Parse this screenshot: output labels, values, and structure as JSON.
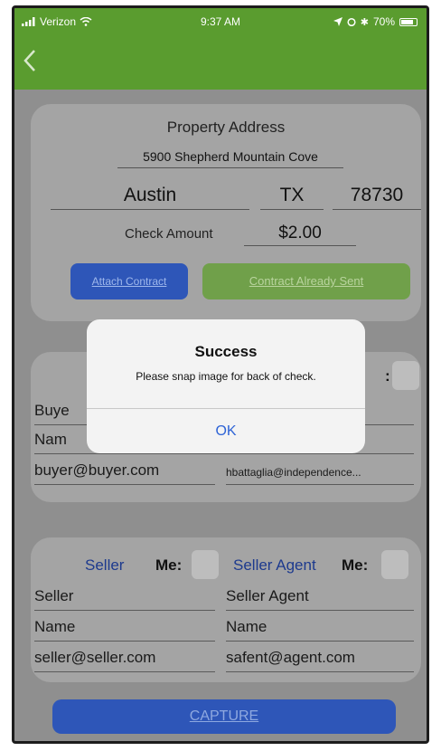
{
  "status_bar": {
    "carrier": "Verizon",
    "time": "9:37 AM",
    "battery": "70%"
  },
  "property": {
    "title": "Property Address",
    "street": "5900 Shepherd Mountain Cove",
    "city": "Austin",
    "state": "TX",
    "zip": "78730",
    "check_amount_label": "Check Amount",
    "check_amount": "$2.00",
    "attach_button": "Attach Contract",
    "sent_button": "Contract Already Sent"
  },
  "buyer": {
    "label": "Buye",
    "name_label": "Nam",
    "email": "buyer@buyer.com",
    "agent_email": "hbattaglia@independence...",
    "colon": ":"
  },
  "seller": {
    "seller_label": "Seller",
    "me_label": "Me:",
    "agent_label": "Seller Agent",
    "agent_me_label": "Me:",
    "seller_field": "Seller",
    "seller_name": "Name",
    "seller_email": "seller@seller.com",
    "agent_field": "Seller Agent",
    "agent_name": "Name",
    "agent_email": "safent@agent.com"
  },
  "capture": {
    "label": "CAPTURE"
  },
  "dialog": {
    "title": "Success",
    "message": "Please snap image for back of check.",
    "ok": "OK"
  },
  "colors": {
    "nav_green": "#5a9c2f",
    "button_blue": "#2e56b8",
    "button_green": "#70a04a",
    "link_blue": "#2d63d6"
  }
}
